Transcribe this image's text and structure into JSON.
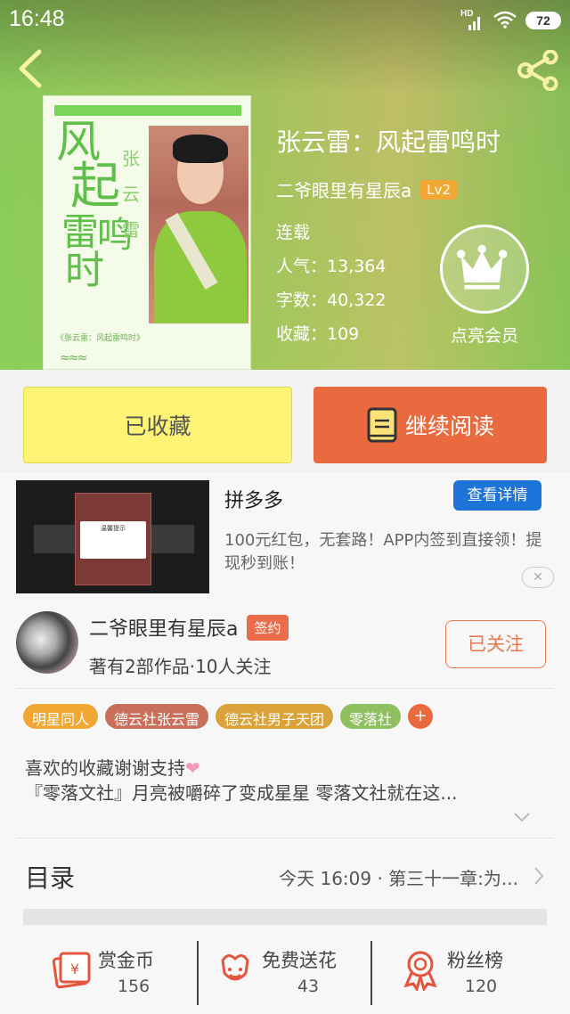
{
  "statusbar": {
    "time": "16:48",
    "network": "HD",
    "battery": "72"
  },
  "book": {
    "title": "张云雷：风起雷鸣时",
    "author": "二爷眼里有星辰a",
    "level": "Lv2",
    "status": "连载",
    "popularity": "人气：13,364",
    "words": "字数：40,322",
    "favorites": "收藏：109",
    "vip_label": "点亮会员"
  },
  "cover": {
    "calligraphy": [
      "风",
      "起",
      "雷",
      "鸣",
      "时"
    ],
    "side_name": "张云雷",
    "caption": "《张云雷：风起雷鸣时》"
  },
  "actions": {
    "collected": "已收藏",
    "continue_reading": "继续阅读"
  },
  "ad": {
    "dialog_text": "温馨提示",
    "name": "拼多多",
    "detail": "查看详情",
    "description": "100元红包，无套路！APP内签到直接领！提现秒到账！"
  },
  "author_block": {
    "name": "二爷眼里有星辰a",
    "sign_badge": "签约",
    "works": "著有2部作品·10人关注",
    "follow": "已关注"
  },
  "tags": [
    {
      "label": "明星同人",
      "color": "#f0a733"
    },
    {
      "label": "德云社张云雷",
      "color": "#c8705c"
    },
    {
      "label": "德云社男子天团",
      "color": "#d9a33a"
    },
    {
      "label": "零落社",
      "color": "#8fbf5e"
    }
  ],
  "tag_add": "+",
  "intro": {
    "line1": "喜欢的收藏谢谢支持",
    "heart": "❤",
    "line2": "『零落文社』月亮被嚼碎了变成星星 零落文社就在这..."
  },
  "toc": {
    "label": "目录",
    "latest": "今天 16:09 · 第三十一章:为..."
  },
  "bottom": {
    "reward": {
      "label": "赏金币",
      "count": "156"
    },
    "flowers": {
      "label": "免费送花",
      "count": "43"
    },
    "fans": {
      "label": "粉丝榜",
      "count": "120"
    }
  }
}
